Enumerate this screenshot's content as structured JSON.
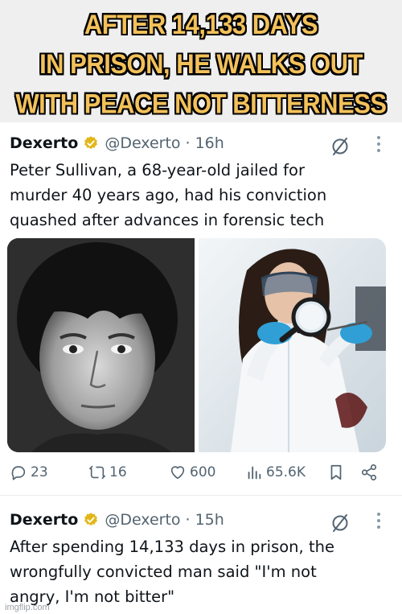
{
  "banner": {
    "caption": "AFTER 14,133 DAYS\nIN PRISON, HE WALKS OUT\nWITH PEACE NOT BITTERNESS"
  },
  "tweets": [
    {
      "display_name": "Dexerto",
      "handle": "@Dexerto",
      "dot": "·",
      "time": "16h",
      "text": "Peter Sullivan, a 68-year-old jailed for\nmurder 40 years ago, had his conviction\nquashed after advances in forensic tech",
      "media": [
        "mugshot-photo",
        "forensic-scientist-photo"
      ],
      "actions": {
        "replies": "23",
        "reposts": "16",
        "likes": "600",
        "views": "65.6K"
      }
    },
    {
      "display_name": "Dexerto",
      "handle": "@Dexerto",
      "dot": "·",
      "time": "15h",
      "text": "After spending 14,133 days in prison, the\nwrongfully convicted man said \"I'm not\nangry, I'm not bitter\""
    }
  ],
  "watermark": "imgflip.com",
  "colors": {
    "banner_text": "#f3c15a",
    "banner_bg": "#efefef",
    "muted": "#536471",
    "verified_gold": "#e2b719"
  }
}
